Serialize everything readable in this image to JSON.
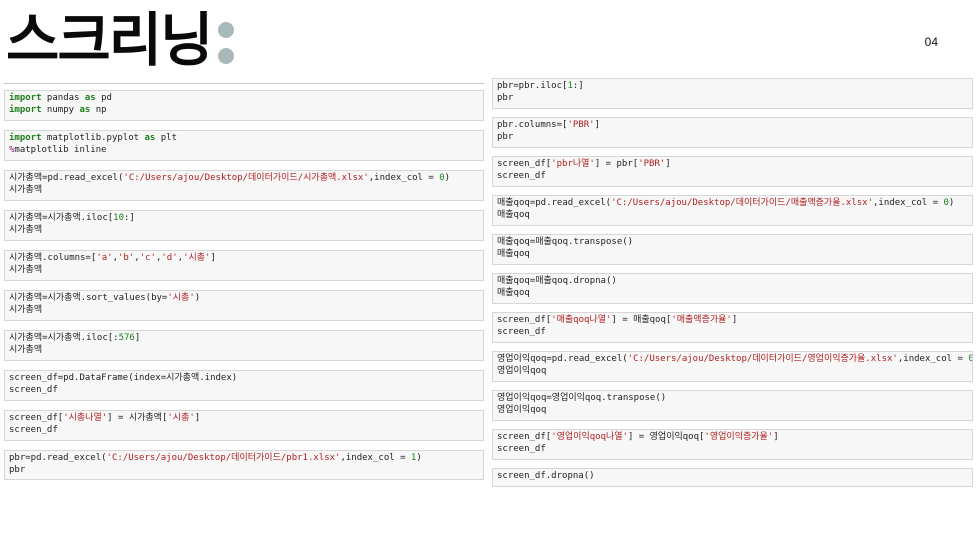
{
  "header": {
    "title": "스크리닝",
    "page_number": "04"
  },
  "left_cells": [
    {
      "in": [
        [
          [
            "kw",
            "import"
          ],
          [
            "t",
            " pandas "
          ],
          [
            "kw",
            "as"
          ],
          [
            "t",
            " pd"
          ]
        ],
        [
          [
            "kw",
            "import"
          ],
          [
            "t",
            " numpy "
          ],
          [
            "kw",
            "as"
          ],
          [
            "t",
            " np"
          ]
        ]
      ],
      "out": ""
    },
    {
      "in": [
        [
          [
            "kw",
            "import"
          ],
          [
            "t",
            " matplotlib.pyplot "
          ],
          [
            "kw",
            "as"
          ],
          [
            "t",
            " plt"
          ]
        ],
        [
          [
            "mg",
            "%"
          ],
          [
            "t",
            "matplotlib inline"
          ]
        ]
      ],
      "out": ""
    },
    {
      "in": [
        [
          [
            "t",
            "시가총액=pd.read_excel("
          ],
          [
            "st",
            "'C:/Users/ajou/Desktop/데이터가이드/시가총액.xlsx'"
          ],
          [
            "t",
            ",index_col = "
          ],
          [
            "nm",
            "0"
          ],
          [
            "t",
            ")"
          ]
        ]
      ],
      "out": "시가총액"
    },
    {
      "in": [
        [
          [
            "t",
            "시가총액=시가총액.iloc["
          ],
          [
            "nm",
            "10"
          ],
          [
            "t",
            ":]"
          ]
        ]
      ],
      "out": "시가총액"
    },
    {
      "in": [
        [
          [
            "t",
            "시가총액.columns=["
          ],
          [
            "st",
            "'a'"
          ],
          [
            "t",
            ","
          ],
          [
            "st",
            "'b'"
          ],
          [
            "t",
            ","
          ],
          [
            "st",
            "'c'"
          ],
          [
            "t",
            ","
          ],
          [
            "st",
            "'d'"
          ],
          [
            "t",
            ","
          ],
          [
            "st",
            "'시총'"
          ],
          [
            "t",
            "]"
          ]
        ]
      ],
      "out": "시가총액"
    },
    {
      "in": [
        [
          [
            "t",
            "시가총액=시가총액.sort_values(by="
          ],
          [
            "st",
            "'시총'"
          ],
          [
            "t",
            ")"
          ]
        ]
      ],
      "out": "시가총액"
    },
    {
      "in": [
        [
          [
            "t",
            "시가총액=시가총액.iloc[:"
          ],
          [
            "nm",
            "576"
          ],
          [
            "t",
            "]"
          ]
        ]
      ],
      "out": "시가총액"
    },
    {
      "in": [
        [
          [
            "t",
            "screen_df=pd.DataFrame(index=시가총액.index)"
          ]
        ]
      ],
      "out": "screen_df"
    },
    {
      "in": [
        [
          [
            "t",
            "screen_df["
          ],
          [
            "st",
            "'시총나열'"
          ],
          [
            "t",
            "] = 시가총액["
          ],
          [
            "st",
            "'시총'"
          ],
          [
            "t",
            "]"
          ]
        ]
      ],
      "out": "screen_df"
    },
    {
      "in": [
        [
          [
            "t",
            "pbr=pd.read_excel("
          ],
          [
            "st",
            "'C:/Users/ajou/Desktop/데이터가이드/pbr1.xlsx'"
          ],
          [
            "t",
            ",index_col = "
          ],
          [
            "nm",
            "1"
          ],
          [
            "t",
            ")"
          ]
        ]
      ],
      "out": "pbr"
    }
  ],
  "right_cells": [
    {
      "in": [
        [
          [
            "t",
            "pbr=pbr.iloc["
          ],
          [
            "nm",
            "1"
          ],
          [
            "t",
            ":]"
          ]
        ]
      ],
      "out": "pbr"
    },
    {
      "in": [
        [
          [
            "t",
            "pbr.columns=["
          ],
          [
            "st",
            "'PBR'"
          ],
          [
            "t",
            "]"
          ]
        ]
      ],
      "out": "pbr"
    },
    {
      "in": [
        [
          [
            "t",
            "screen_df["
          ],
          [
            "st",
            "'pbr나열'"
          ],
          [
            "t",
            "] = pbr["
          ],
          [
            "st",
            "'PBR'"
          ],
          [
            "t",
            "]"
          ]
        ]
      ],
      "out": "screen_df"
    },
    {
      "in": [
        [
          [
            "t",
            "매출qoq=pd.read_excel("
          ],
          [
            "st",
            "'C:/Users/ajou/Desktop/데이터가이드/매출액증가율.xlsx'"
          ],
          [
            "t",
            ",index_col = "
          ],
          [
            "nm",
            "0"
          ],
          [
            "t",
            ")"
          ]
        ]
      ],
      "out": "매출qoq"
    },
    {
      "in": [
        [
          [
            "t",
            "매출qoq=매출qoq.transpose()"
          ]
        ]
      ],
      "out": "매출qoq"
    },
    {
      "in": [
        [
          [
            "t",
            "매출qoq=매출qoq.dropna()"
          ]
        ]
      ],
      "out": "매출qoq"
    },
    {
      "in": [
        [
          [
            "t",
            "screen_df["
          ],
          [
            "st",
            "'매출qoq나열'"
          ],
          [
            "t",
            "] = 매출qoq["
          ],
          [
            "st",
            "'매출액증가율'"
          ],
          [
            "t",
            "]"
          ]
        ]
      ],
      "out": "screen_df"
    },
    {
      "in": [
        [
          [
            "t",
            "영업이익qoq=pd.read_excel("
          ],
          [
            "st",
            "'C:/Users/ajou/Desktop/데이터가이드/영업이익증가율.xlsx'"
          ],
          [
            "t",
            ",index_col = "
          ],
          [
            "nm",
            "0"
          ],
          [
            "t",
            ")"
          ]
        ]
      ],
      "out": "영업이익qoq"
    },
    {
      "in": [
        [
          [
            "t",
            "영업이익qoq=영업이익qoq.transpose()"
          ]
        ]
      ],
      "out": "영업이익qoq"
    },
    {
      "in": [
        [
          [
            "t",
            "screen_df["
          ],
          [
            "st",
            "'영업이익qoq나열'"
          ],
          [
            "t",
            "] = 영업이익qoq["
          ],
          [
            "st",
            "'영업이익증가율'"
          ],
          [
            "t",
            "]"
          ]
        ]
      ],
      "out": "screen_df"
    },
    {
      "in": [
        [
          [
            "t",
            "screen_df.dropna()"
          ]
        ]
      ],
      "out": ""
    }
  ],
  "colors": {
    "keyword": "#1a7f1a",
    "string": "#b02020",
    "magic": "#a0208f",
    "cell_bg": "#f7f7f7",
    "cell_border": "#d6d6d6",
    "title_dots": "#a9b8b8"
  }
}
